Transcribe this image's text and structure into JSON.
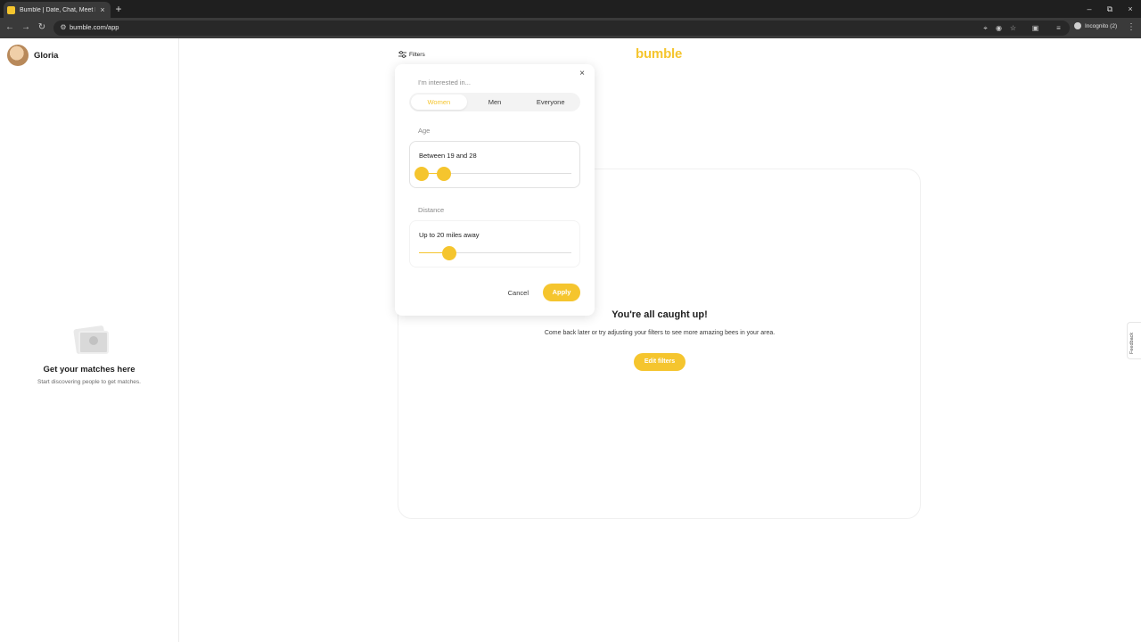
{
  "browser": {
    "tab_title": "Bumble | Date, Chat, Meet New",
    "tab_close": "×",
    "new_tab": "+",
    "url": "bumble.com/app",
    "incognito_label": "Incognito (2)",
    "win_minimize": "–",
    "win_restore": "⧉",
    "win_close": "×",
    "nav_back": "←",
    "nav_forward": "→",
    "nav_reload": "↻",
    "menu": "⋮"
  },
  "sidebar": {
    "profile_name": "Gloria",
    "matches_title": "Get your matches here",
    "matches_subtitle": "Start discovering people to get matches."
  },
  "header": {
    "filters_label": "Filters",
    "logo": "bumble"
  },
  "feed": {
    "title": "You're all caught up!",
    "subtitle": "Come back later or try adjusting your filters to see more amazing bees in your area.",
    "edit_filters_label": "Edit filters"
  },
  "feedback_label": "Feedback",
  "filters_modal": {
    "close": "×",
    "interested_label": "I'm interested in...",
    "interest_options": [
      "Women",
      "Men",
      "Everyone"
    ],
    "selected_interest": "Women",
    "age_label": "Age",
    "age_text": "Between 19 and 28",
    "age_min": 19,
    "age_max": 28,
    "distance_label": "Distance",
    "distance_text": "Up to 20 miles away",
    "distance_miles": 20,
    "cancel_label": "Cancel",
    "apply_label": "Apply"
  },
  "colors": {
    "brand_yellow": "#f5c52e",
    "chrome_dark": "#1f1f1f",
    "chrome_toolbar": "#3a3a3a"
  }
}
